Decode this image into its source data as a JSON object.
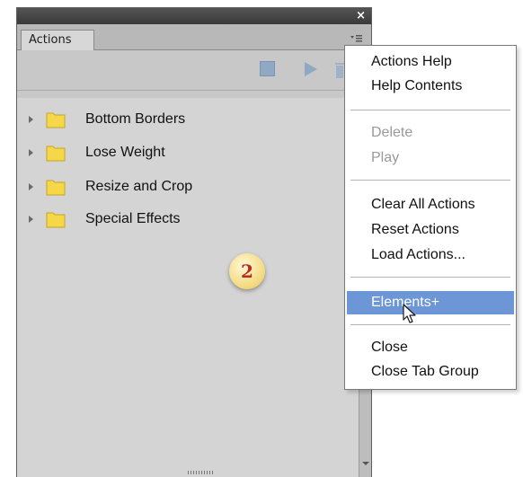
{
  "panel": {
    "close_glyph": "×",
    "tab_label": "Actions",
    "actions": [
      {
        "label": "Bottom Borders"
      },
      {
        "label": "Lose Weight"
      },
      {
        "label": "Resize and Crop"
      },
      {
        "label": "Special Effects"
      }
    ],
    "colors": {
      "folder": "#f5d84a",
      "stop_button": "#8fa8c4",
      "play_button": "#8fa8c4"
    }
  },
  "annotation": {
    "step_number": "2"
  },
  "menu": {
    "groups": [
      [
        {
          "label": "Actions Help",
          "enabled": true
        },
        {
          "label": "Help Contents",
          "enabled": true
        }
      ],
      [
        {
          "label": "Delete",
          "enabled": false
        },
        {
          "label": "Play",
          "enabled": false
        }
      ],
      [
        {
          "label": "Clear All Actions",
          "enabled": true
        },
        {
          "label": "Reset Actions",
          "enabled": true
        },
        {
          "label": "Load Actions...",
          "enabled": true
        }
      ],
      [
        {
          "label": "Elements+",
          "enabled": true,
          "highlighted": true
        }
      ],
      [
        {
          "label": "Close",
          "enabled": true
        },
        {
          "label": "Close Tab Group",
          "enabled": true
        }
      ]
    ],
    "highlight_color": "#6c96d6"
  }
}
